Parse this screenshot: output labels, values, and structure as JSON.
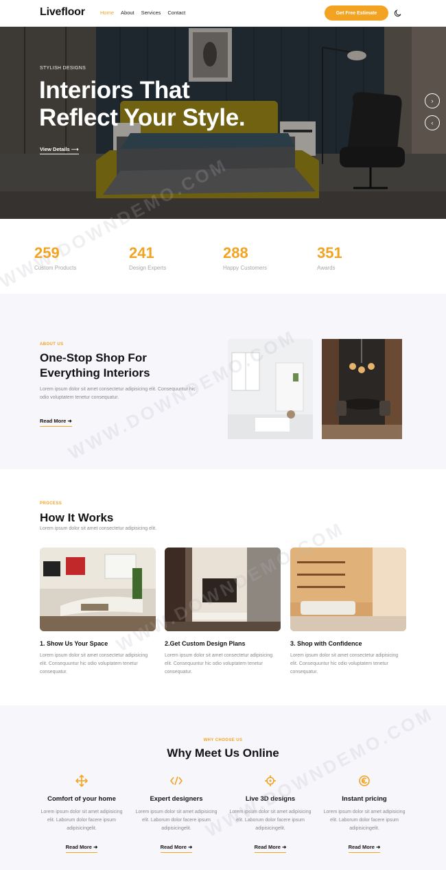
{
  "nav": {
    "logo": "Livefloor",
    "items": [
      {
        "label": "Home",
        "active": true
      },
      {
        "label": "About",
        "active": false
      },
      {
        "label": "Services",
        "active": false
      },
      {
        "label": "Contact",
        "active": false
      }
    ],
    "cta": "Get Free Estimate",
    "theme_icon": "moon-icon"
  },
  "hero": {
    "eyebrow": "STYLISH DESIGNS",
    "title_line1": "Interiors That",
    "title_line2": "Reflect Your Style.",
    "link": "View Details",
    "next_icon": "chevron-right-icon",
    "prev_icon": "chevron-left-icon"
  },
  "stats": [
    {
      "value": "259",
      "label": "Custom Products"
    },
    {
      "value": "241",
      "label": "Design Experts"
    },
    {
      "value": "288",
      "label": "Happy Customers"
    },
    {
      "value": "351",
      "label": "Awards"
    }
  ],
  "about": {
    "eyebrow": "ABOUT US",
    "title_line1": "One-Stop Shop For",
    "title_line2": "Everything Interiors",
    "text": "Lorem ipsum dolor sit amet consectetur adipisicing elit. Consequuntur hic odio voluptatem tenetur consequatur.",
    "link": "Read More"
  },
  "process": {
    "eyebrow": "PROCESS",
    "title": "How It Works",
    "subtitle": "Lorem ipsum dolor sit amet consectetur adipisicing elit.",
    "steps": [
      {
        "title": "1. Show Us Your Space",
        "text": "Lorem ipsum dolor sit amet consectetur adipisicing elit. Consequuntur hic odio voluptatem tenetur consequatur."
      },
      {
        "title": "2.Get Custom Design Plans",
        "text": "Lorem ipsum dolor sit amet consectetur adipisicing elit. Consequuntur hic odio voluptatem tenetur consequatur."
      },
      {
        "title": "3. Shop with Confidence",
        "text": "Lorem ipsum dolor sit amet consectetur adipisicing elit. Consequuntur hic odio voluptatem tenetur consequatur."
      }
    ]
  },
  "why": {
    "eyebrow": "WHY CHOOSE US",
    "title": "Why Meet Us Online",
    "features": [
      {
        "icon": "move-arrows-icon",
        "title": "Comfort of your home",
        "text": "Lorem ipsum dolor sit amet adipisicing elit. Laborum dolor facere ipsum adipisicingelit.",
        "link": "Read More"
      },
      {
        "icon": "code-icon",
        "title": "Expert designers",
        "text": "Lorem ipsum dolor sit amet adipisicing elit. Laborum dolor facere ipsum adipisicingelit.",
        "link": "Read More"
      },
      {
        "icon": "crosshair-icon",
        "title": "Live 3D designs",
        "text": "Lorem ipsum dolor sit amet adipisicing elit. Laborum dolor facere ipsum adipisicingelit.",
        "link": "Read More"
      },
      {
        "icon": "price-tag-icon",
        "title": "Instant pricing",
        "text": "Lorem ipsum dolor sit amet adipisicing elit. Laborum dolor facere ipsum adipisicingelit.",
        "link": "Read More"
      }
    ]
  },
  "watermark": "WWW.DOWNDEMO.COM",
  "colors": {
    "accent": "#f3a322",
    "text": "#111111",
    "muted": "#8a8a8a",
    "section_bg": "#f7f6fb"
  }
}
